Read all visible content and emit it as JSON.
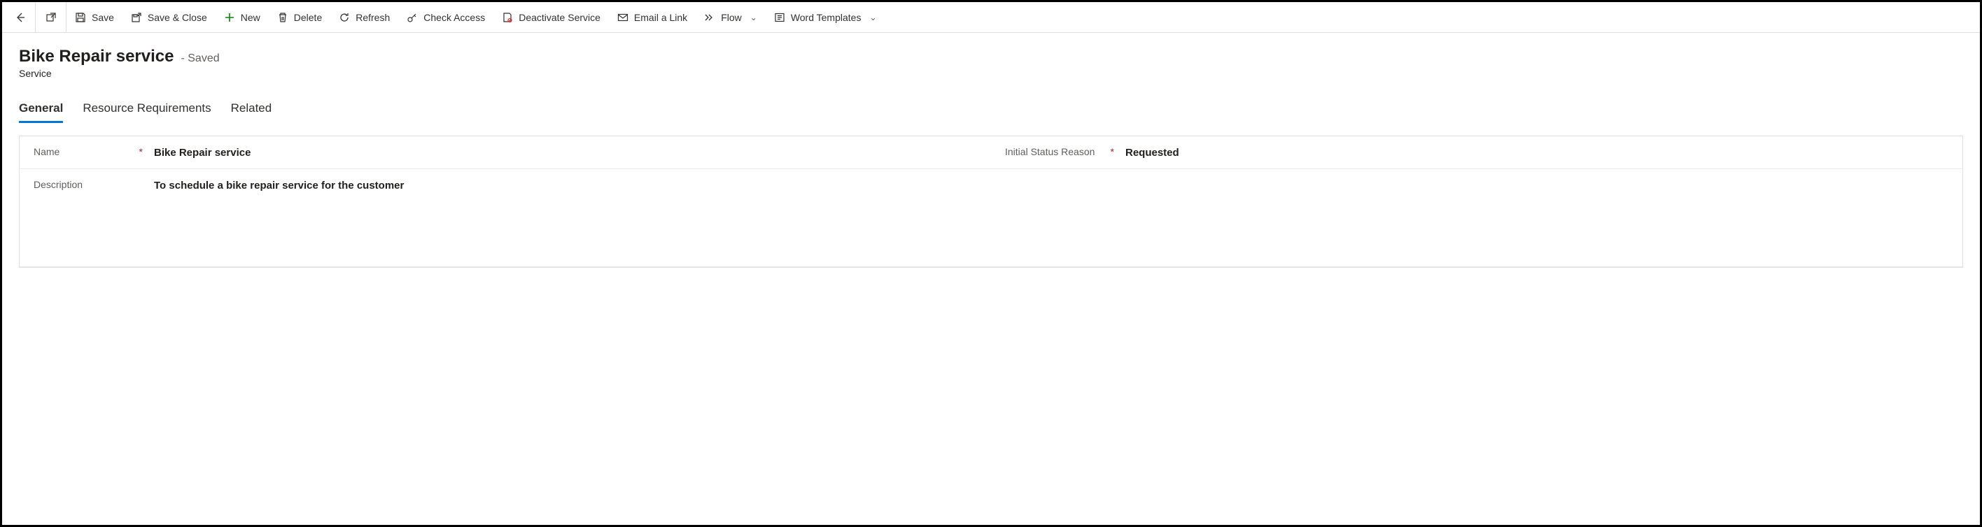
{
  "toolbar": {
    "save": "Save",
    "saveClose": "Save & Close",
    "new": "New",
    "delete": "Delete",
    "refresh": "Refresh",
    "checkAccess": "Check Access",
    "deactivate": "Deactivate Service",
    "emailLink": "Email a Link",
    "flow": "Flow",
    "wordTemplates": "Word Templates"
  },
  "header": {
    "title": "Bike Repair service",
    "savedLabel": "- Saved",
    "entity": "Service"
  },
  "tabs": {
    "general": "General",
    "resource": "Resource Requirements",
    "related": "Related"
  },
  "form": {
    "nameLabel": "Name",
    "nameValue": "Bike Repair service",
    "statusLabel": "Initial Status Reason",
    "statusValue": "Requested",
    "descriptionLabel": "Description",
    "descriptionValue": "To schedule a bike repair service for the customer"
  }
}
